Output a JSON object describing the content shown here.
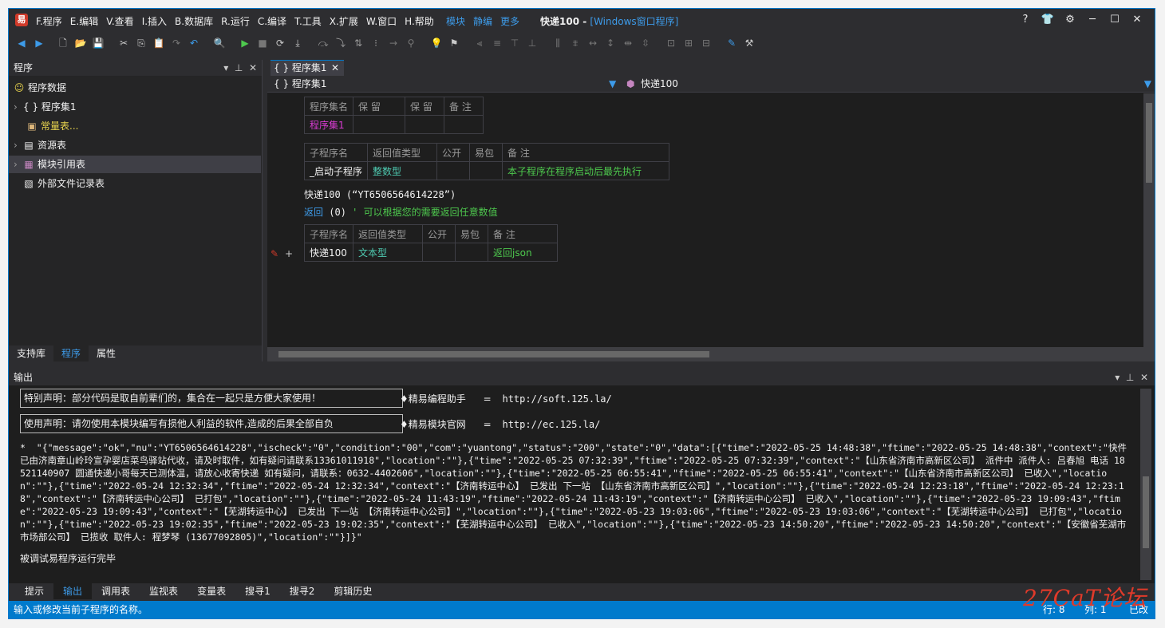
{
  "titlebar": {
    "logo_glyph": "易",
    "menus": [
      "F.程序",
      "E.编辑",
      "V.查看",
      "I.插入",
      "B.数据库",
      "R.运行",
      "C.编译",
      "T.工具",
      "X.扩展",
      "W.窗口",
      "H.帮助"
    ],
    "extra_menus": [
      "模块",
      "静编",
      "更多"
    ],
    "doc_title": "快递100 - ",
    "doc_title_sub": "[Windows窗口程序]"
  },
  "left_panel": {
    "title": "程序",
    "items": [
      {
        "label": "程序数据",
        "icon": "😊"
      },
      {
        "label": "{ } 程序集1",
        "icon": ">"
      },
      {
        "label": "常量表...",
        "icon": "▣"
      },
      {
        "label": "资源表",
        "icon": "▤"
      },
      {
        "label": "模块引用表",
        "icon": "▦"
      },
      {
        "label": "外部文件记录表",
        "icon": "▧"
      }
    ],
    "tabs": [
      "支持库",
      "程序",
      "属性"
    ]
  },
  "editor": {
    "tab": "{ } 程序集1",
    "nav_left": "{ } 程序集1",
    "nav_right": "快递100",
    "table1": {
      "headers": [
        "程序集名",
        "保 留",
        "保 留",
        "备 注"
      ],
      "row": [
        "程序集1",
        "",
        "",
        ""
      ]
    },
    "table2": {
      "headers": [
        "子程序名",
        "返回值类型",
        "公开",
        "易包",
        "备 注"
      ],
      "row": [
        "_启动子程序",
        "整数型",
        "",
        "",
        "本子程序在程序启动后最先执行"
      ]
    },
    "line1": "快递100 (“YT6506564614228”)",
    "line2_kw": "返回",
    "line2_val": " (0) ",
    "line2_comment": "' 可以根据您的需要返回任意数值",
    "table3": {
      "headers": [
        "子程序名",
        "返回值类型",
        "公开",
        "易包",
        "备 注"
      ],
      "row": [
        "快递100",
        "文本型",
        "",
        "",
        "返回json"
      ]
    },
    "gutter_plus": "+"
  },
  "output": {
    "title": "输出",
    "box1": "特别声明：部分代码是取自前辈们的，集合在一起只是方便大家使用！",
    "box2": "使用声明：请勿使用本模块编写有损他人利益的软件,造成的后果全部自负",
    "link1_label": "♦精易编程助手",
    "link1_eq": "=",
    "link1_url": "http://soft.125.la/",
    "link2_label": "♦精易模块官网",
    "link2_eq": "=",
    "link2_url": "http://ec.125.la/",
    "json_text": "*  \"{\"message\":\"ok\",\"nu\":\"YT6506564614228\",\"ischeck\":\"0\",\"condition\":\"00\",\"com\":\"yuantong\",\"status\":\"200\",\"state\":\"0\",\"data\":[{\"time\":\"2022-05-25 14:48:38\",\"ftime\":\"2022-05-25 14:48:38\",\"context\":\"快件已由济南章山岭玲宣孕婴店菜鸟驿站代收，请及时取件，如有疑问请联系13361011918\",\"location\":\"\"},{\"time\":\"2022-05-25 07:32:39\",\"ftime\":\"2022-05-25 07:32:39\",\"context\":\"【山东省济南市高新区公司】 派件中 派件人: 吕春旭 电话 18521140907 圆通快递小哥每天已测体温，请放心收寄快递 如有疑问，请联系：0632-4402606\",\"location\":\"\"},{\"time\":\"2022-05-25 06:55:41\",\"ftime\":\"2022-05-25 06:55:41\",\"context\":\"【山东省济南市高新区公司】 已收入\",\"location\":\"\"},{\"time\":\"2022-05-24 12:32:34\",\"ftime\":\"2022-05-24 12:32:34\",\"context\":\"【济南转运中心】 已发出 下一站 【山东省济南市高新区公司】\",\"location\":\"\"},{\"time\":\"2022-05-24 12:23:18\",\"ftime\":\"2022-05-24 12:23:18\",\"context\":\"【济南转运中心公司】 已打包\",\"location\":\"\"},{\"time\":\"2022-05-24 11:43:19\",\"ftime\":\"2022-05-24 11:43:19\",\"context\":\"【济南转运中心公司】 已收入\",\"location\":\"\"},{\"time\":\"2022-05-23 19:09:43\",\"ftime\":\"2022-05-23 19:09:43\",\"context\":\"【芜湖转运中心】 已发出 下一站 【济南转运中心公司】\",\"location\":\"\"},{\"time\":\"2022-05-23 19:03:06\",\"ftime\":\"2022-05-23 19:03:06\",\"context\":\"【芜湖转运中心公司】 已打包\",\"location\":\"\"},{\"time\":\"2022-05-23 19:02:35\",\"ftime\":\"2022-05-23 19:02:35\",\"context\":\"【芜湖转运中心公司】 已收入\",\"location\":\"\"},{\"time\":\"2022-05-23 14:50:20\",\"ftime\":\"2022-05-23 14:50:20\",\"context\":\"【安徽省芜湖市市场部公司】 已揽收 取件人: 程梦琴 (13677092805)\",\"location\":\"\"}]}\"",
    "done_text": "被调试易程序运行完毕"
  },
  "bottom_tabs": [
    "提示",
    "输出",
    "调用表",
    "监视表",
    "变量表",
    "搜寻1",
    "搜寻2",
    "剪辑历史"
  ],
  "status": {
    "hint": "输入或修改当前子程序的名称。",
    "row": "行: 8",
    "col": "列: 1",
    "mode": "已改"
  },
  "watermark": "27CaT论坛",
  "colors": {
    "accent": "#007acc",
    "keyword": "#3d9be9",
    "comment": "#4ec94e",
    "type": "#4ec9b0",
    "name": "#d83bd2"
  }
}
